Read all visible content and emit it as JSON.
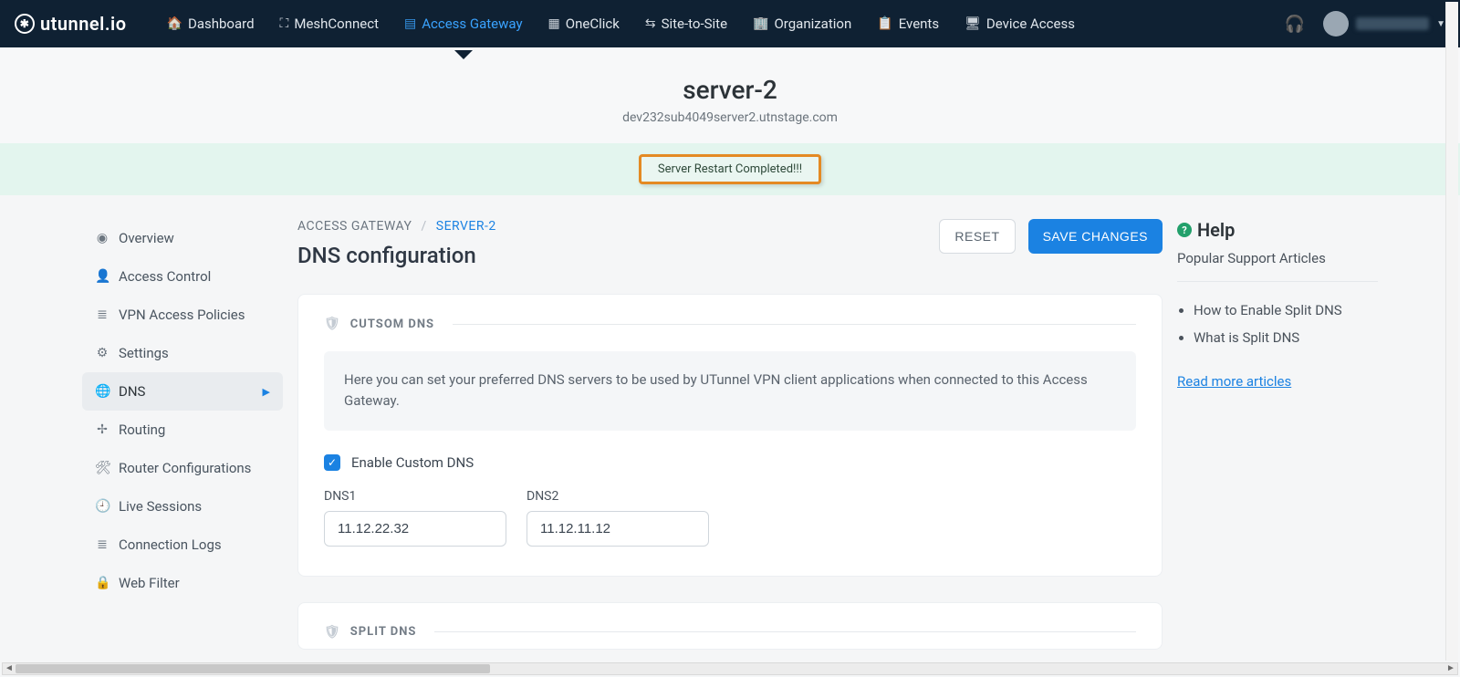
{
  "brand": "utunnel.io",
  "nav": [
    {
      "label": "Dashboard",
      "icon": "🏠",
      "name": "nav-dashboard"
    },
    {
      "label": "MeshConnect",
      "icon": "⛶",
      "name": "nav-meshconnect"
    },
    {
      "label": "Access Gateway",
      "icon": "▤",
      "name": "nav-access-gateway",
      "active": true
    },
    {
      "label": "OneClick",
      "icon": "▦",
      "name": "nav-oneclick"
    },
    {
      "label": "Site-to-Site",
      "icon": "⇆",
      "name": "nav-site-to-site"
    },
    {
      "label": "Organization",
      "icon": "🏢",
      "name": "nav-organization"
    },
    {
      "label": "Events",
      "icon": "📋",
      "name": "nav-events"
    },
    {
      "label": "Device Access",
      "icon": "🖥",
      "name": "nav-device-access"
    }
  ],
  "header": {
    "title": "server-2",
    "subtitle": "dev232sub4049server2.utnstage.com"
  },
  "alert": {
    "text": "Server Restart Completed!!!"
  },
  "breadcrumb": {
    "root": "ACCESS GATEWAY",
    "current": "SERVER-2"
  },
  "sectionTitle": "DNS configuration",
  "buttons": {
    "reset": "RESET",
    "save": "SAVE CHANGES"
  },
  "sidebar": [
    {
      "label": "Overview",
      "icon": "◉",
      "name": "side-overview"
    },
    {
      "label": "Access Control",
      "icon": "👤",
      "name": "side-access-control"
    },
    {
      "label": "VPN Access Policies",
      "icon": "≣",
      "name": "side-vpn-policies"
    },
    {
      "label": "Settings",
      "icon": "⚙",
      "name": "side-settings"
    },
    {
      "label": "DNS",
      "icon": "🌐",
      "name": "side-dns",
      "active": true
    },
    {
      "label": "Routing",
      "icon": "✢",
      "name": "side-routing"
    },
    {
      "label": "Router Configurations",
      "icon": "🛠",
      "name": "side-router-config"
    },
    {
      "label": "Live Sessions",
      "icon": "🕘",
      "name": "side-live-sessions"
    },
    {
      "label": "Connection Logs",
      "icon": "≣",
      "name": "side-connection-logs"
    },
    {
      "label": "Web Filter",
      "icon": "🔒",
      "name": "side-web-filter"
    }
  ],
  "customDns": {
    "heading": "CUTSOM DNS",
    "info": "Here you can set your preferred DNS servers to be used by UTunnel VPN client applications when connected to this Access Gateway.",
    "checkboxLabel": "Enable Custom DNS",
    "dns1Label": "DNS1",
    "dns1Value": "11.12.22.32",
    "dns2Label": "DNS2",
    "dns2Value": "11.12.11.12"
  },
  "splitDns": {
    "heading": "SPLIT DNS"
  },
  "help": {
    "title": "Help",
    "subtitle": "Popular Support Articles",
    "articles": [
      "How to Enable Split DNS",
      "What is Split DNS"
    ],
    "moreLink": "Read more articles"
  }
}
